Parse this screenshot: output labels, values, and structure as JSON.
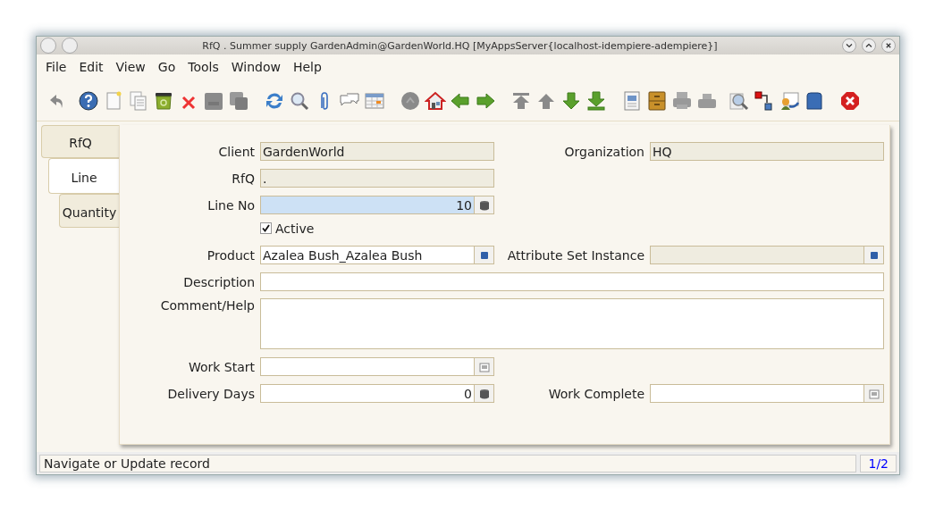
{
  "window": {
    "title": "RfQ  .  Summer supply  GardenAdmin@GardenWorld.HQ [MyAppsServer{localhost-idempiere-adempiere}]"
  },
  "menu": [
    "File",
    "Edit",
    "View",
    "Go",
    "Tools",
    "Window",
    "Help"
  ],
  "tabs": [
    {
      "label": "RfQ",
      "selected": false
    },
    {
      "label": "Line",
      "selected": true
    },
    {
      "label": "Quantity",
      "selected": false
    }
  ],
  "rows": [
    [
      {
        "label": "Client",
        "kind": "text",
        "value": "GardenWorld",
        "readonly": true,
        "focused": false
      },
      {
        "label": "Organization",
        "kind": "text",
        "value": "HQ",
        "readonly": true,
        "focused": false
      }
    ],
    [
      {
        "label": "RfQ",
        "kind": "text",
        "value": ".",
        "readonly": true,
        "focused": false
      }
    ],
    [
      {
        "label": "Line No",
        "kind": "number",
        "value": "10",
        "readonly": false,
        "focused": true
      }
    ],
    [
      {
        "label": "Active",
        "kind": "checkbox",
        "checked": true
      }
    ],
    [
      {
        "label": "Product",
        "kind": "lookup",
        "value": "Azalea Bush_Azalea Bush",
        "readonly": false,
        "focused": false
      },
      {
        "label": "Attribute Set Instance",
        "kind": "lookup",
        "readonly": true,
        "focused": false
      }
    ],
    [
      {
        "label": "Description",
        "kind": "long-text",
        "readonly": false,
        "focused": false
      }
    ],
    [
      {
        "label": "Comment/Help",
        "kind": "memo",
        "readonly": false,
        "focused": false
      }
    ],
    [
      {
        "label": "Work Start",
        "kind": "date",
        "readonly": false,
        "focused": false
      }
    ],
    [
      {
        "label": "Delivery Days",
        "kind": "number",
        "value": "0",
        "readonly": false,
        "focused": false
      },
      {
        "label": "Work Complete",
        "kind": "date",
        "readonly": false,
        "focused": false
      }
    ]
  ],
  "status_bar": {
    "message": "Navigate or Update record",
    "record": "1/2"
  }
}
